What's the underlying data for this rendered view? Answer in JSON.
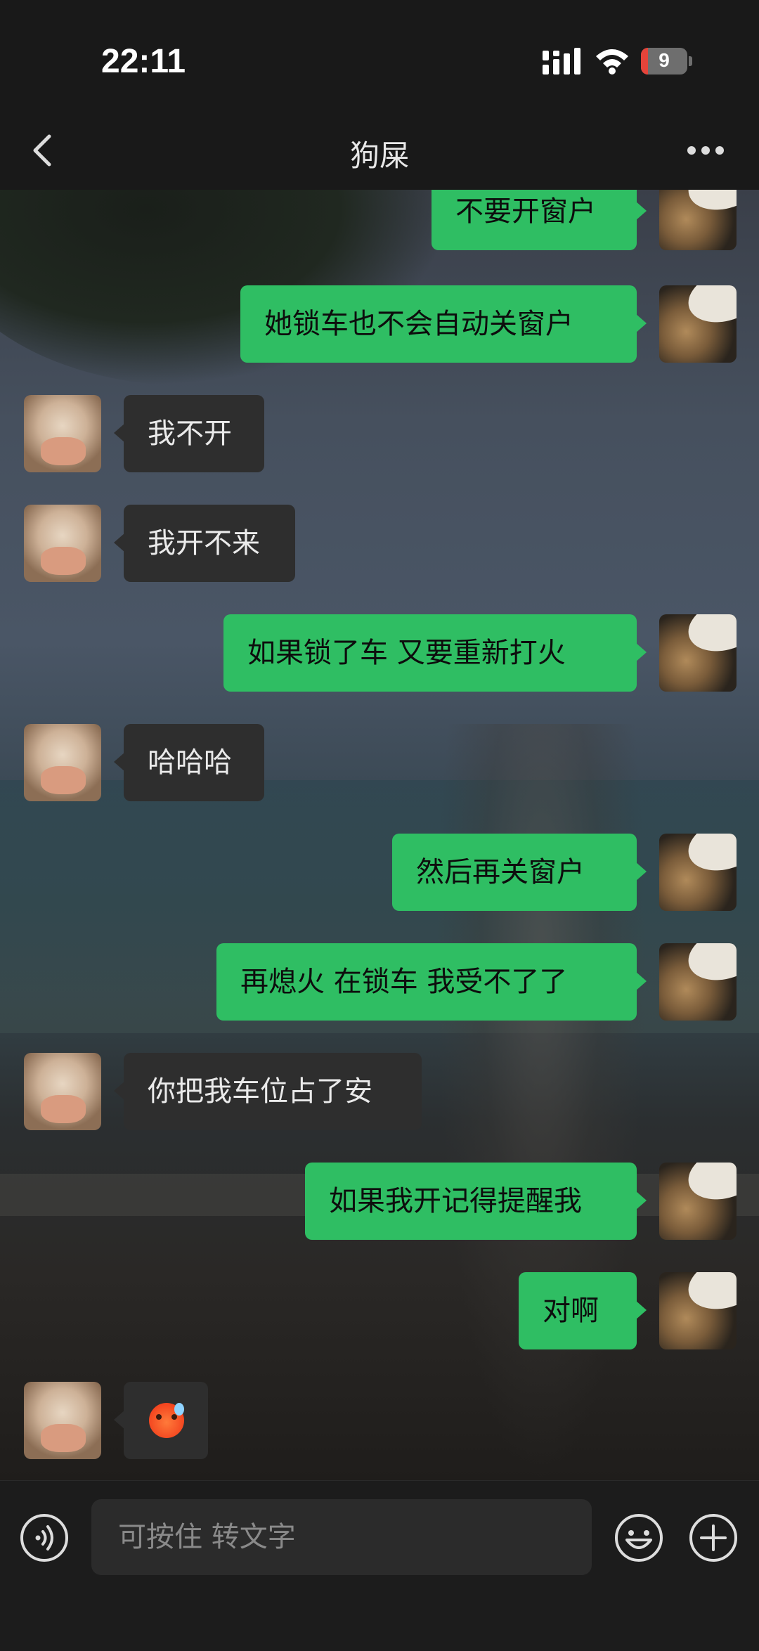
{
  "status": {
    "time": "22:11",
    "battery": "9"
  },
  "nav": {
    "title": "狗屎"
  },
  "messages": [
    {
      "side": "out",
      "text": "不要开窗户"
    },
    {
      "side": "out",
      "text": "她锁车也不会自动关窗户"
    },
    {
      "side": "in",
      "text": "我不开"
    },
    {
      "side": "in",
      "text": "我开不来"
    },
    {
      "side": "out",
      "text": "如果锁了车 又要重新打火"
    },
    {
      "side": "in",
      "text": "哈哈哈"
    },
    {
      "side": "out",
      "text": "然后再关窗户"
    },
    {
      "side": "out",
      "text": "再熄火 在锁车 我受不了了"
    },
    {
      "side": "in",
      "text": "你把我车位占了安"
    },
    {
      "side": "out",
      "text": "如果我开记得提醒我"
    },
    {
      "side": "out",
      "text": "对啊"
    },
    {
      "side": "in",
      "text": "",
      "emoji": "sweat-smile-emoji"
    }
  ],
  "input": {
    "placeholder": "可按住 转文字"
  },
  "icons": {
    "back": "back-chevron-icon",
    "more": "more-dots-icon",
    "voice": "voice-icon",
    "emoji": "emoji-icon",
    "plus": "plus-icon",
    "signal": "signal-icon",
    "wifi": "wifi-icon",
    "battery": "battery-icon"
  },
  "colors": {
    "outgoing": "#2fbe63",
    "incoming": "#2e2e2e",
    "bar": "#191919"
  }
}
